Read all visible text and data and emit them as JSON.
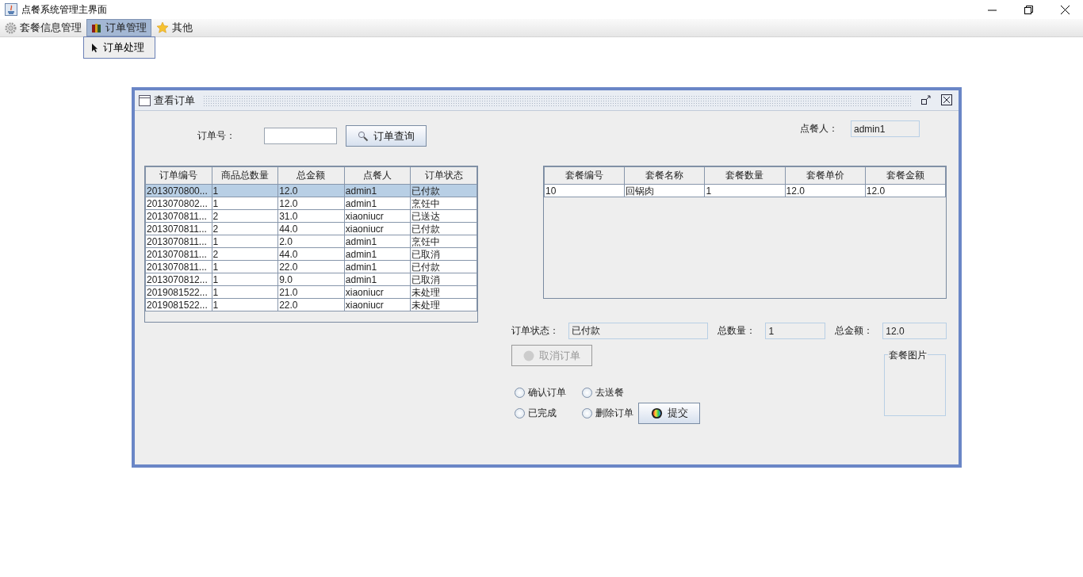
{
  "window": {
    "title": "点餐系统管理主界面"
  },
  "menu": [
    {
      "label": "套餐信息管理",
      "selected": false
    },
    {
      "label": "订单管理",
      "selected": true
    },
    {
      "label": "其他",
      "selected": false
    }
  ],
  "open_menu": {
    "items": [
      {
        "label": "订单处理"
      }
    ]
  },
  "internal_frame": {
    "title": "查看订单",
    "order_search": {
      "label": "订单号：",
      "button": "订单查询"
    },
    "orders_table": {
      "columns": [
        "订单编号",
        "商品总数量",
        "总金额",
        "点餐人",
        "订单状态"
      ],
      "rows": [
        {
          "cells": [
            "2013070800...",
            "1",
            "12.0",
            "admin1",
            "已付款"
          ],
          "selected": true
        },
        {
          "cells": [
            "2013070802...",
            "1",
            "12.0",
            "admin1",
            "烹饪中"
          ],
          "selected": false
        },
        {
          "cells": [
            "2013070811...",
            "2",
            "31.0",
            "xiaoniucr",
            "已送达"
          ],
          "selected": false
        },
        {
          "cells": [
            "2013070811...",
            "2",
            "44.0",
            "xiaoniucr",
            "已付款"
          ],
          "selected": false
        },
        {
          "cells": [
            "2013070811...",
            "1",
            "2.0",
            "admin1",
            "烹饪中"
          ],
          "selected": false
        },
        {
          "cells": [
            "2013070811...",
            "2",
            "44.0",
            "admin1",
            "已取消"
          ],
          "selected": false
        },
        {
          "cells": [
            "2013070811...",
            "1",
            "22.0",
            "admin1",
            "已付款"
          ],
          "selected": false
        },
        {
          "cells": [
            "2013070812...",
            "1",
            "9.0",
            "admin1",
            "已取消"
          ],
          "selected": false
        },
        {
          "cells": [
            "2019081522...",
            "1",
            "21.0",
            "xiaoniucr",
            "未处理"
          ],
          "selected": false
        },
        {
          "cells": [
            "2019081522...",
            "1",
            "22.0",
            "xiaoniucr",
            "未处理"
          ],
          "selected": false
        }
      ]
    },
    "customer": {
      "label": "点餐人：",
      "value": "admin1"
    },
    "items_table": {
      "columns": [
        "套餐编号",
        "套餐名称",
        "套餐数量",
        "套餐单价",
        "套餐金额"
      ],
      "rows": [
        {
          "cells": [
            "10",
            "回锅肉",
            "1",
            "12.0",
            "12.0"
          ],
          "selected": false
        }
      ]
    },
    "status_fields": [
      {
        "label": "订单状态：",
        "value": "已付款"
      },
      {
        "label": "总数量：",
        "value": "1"
      },
      {
        "label": "总金额：",
        "value": "12.0"
      }
    ],
    "cancel_button": {
      "label": "取消订单",
      "disabled": true
    },
    "actions": [
      {
        "label": "确认订单",
        "selected": false
      },
      {
        "label": "去送餐",
        "selected": false
      },
      {
        "label": "已完成",
        "selected": false
      },
      {
        "label": "删除订单",
        "selected": false
      }
    ],
    "submit_button": {
      "label": "提交",
      "disabled": false
    },
    "picture_group": {
      "title": "套餐图片"
    }
  }
}
